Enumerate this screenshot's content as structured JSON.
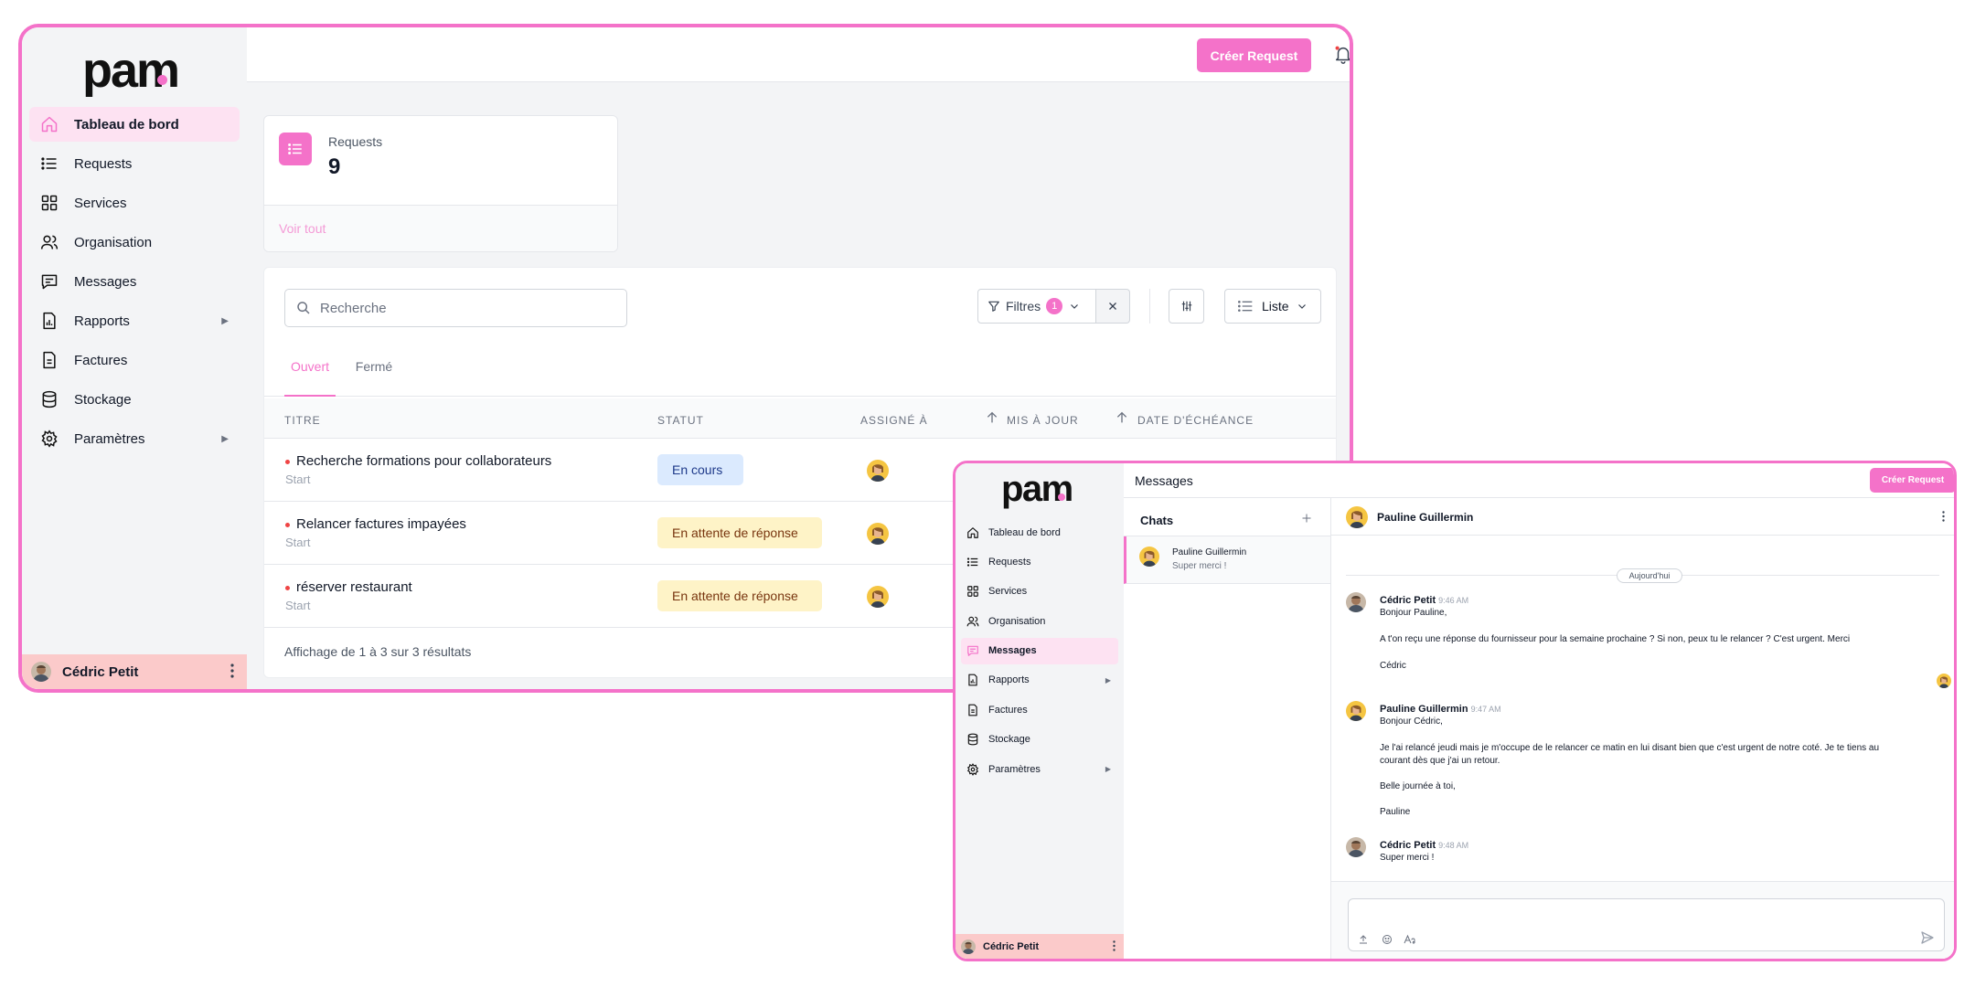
{
  "app": {
    "logo_text": "pam",
    "brand_color": "#f472c9"
  },
  "dashboard": {
    "sidebar": {
      "items": [
        {
          "label": "Tableau de bord",
          "icon": "home-icon",
          "active": true
        },
        {
          "label": "Requests",
          "icon": "list-icon"
        },
        {
          "label": "Services",
          "icon": "grid-icon"
        },
        {
          "label": "Organisation",
          "icon": "users-icon"
        },
        {
          "label": "Messages",
          "icon": "chat-icon"
        },
        {
          "label": "Rapports",
          "icon": "report-icon",
          "has_submenu": true
        },
        {
          "label": "Factures",
          "icon": "invoice-icon"
        },
        {
          "label": "Stockage",
          "icon": "database-icon"
        },
        {
          "label": "Paramètres",
          "icon": "gear-icon",
          "has_submenu": true
        }
      ],
      "user_name": "Cédric Petit"
    },
    "header": {
      "create_button": "Créer Request"
    },
    "stat_card": {
      "label": "Requests",
      "value": "9",
      "link": "Voir tout"
    },
    "toolbar": {
      "search_placeholder": "Recherche",
      "filters_label": "Filtres",
      "filters_count": "1",
      "view_label": "Liste"
    },
    "tabs": [
      {
        "label": "Ouvert",
        "active": true
      },
      {
        "label": "Fermé"
      }
    ],
    "table": {
      "headers": {
        "title": "Titre",
        "status": "Statut",
        "assigned": "Assigné à",
        "updated": "Mis à jour",
        "due": "Date d'échéance"
      },
      "rows": [
        {
          "title": "Recherche formations pour collaborateurs",
          "sub": "Start",
          "status": "En cours",
          "status_color": "#dbeafe"
        },
        {
          "title": "Relancer factures impayées",
          "sub": "Start",
          "status": "En attente de réponse",
          "status_color": "#fef3c7"
        },
        {
          "title": "réserver restaurant",
          "sub": "Start",
          "status": "En attente de réponse",
          "status_color": "#fef3c7"
        }
      ],
      "footer": "Affichage de 1 à 3 sur 3 résultats"
    }
  },
  "messages_window": {
    "sidebar": {
      "items": [
        {
          "label": "Tableau de bord",
          "icon": "home-icon"
        },
        {
          "label": "Requests",
          "icon": "list-icon"
        },
        {
          "label": "Services",
          "icon": "grid-icon"
        },
        {
          "label": "Organisation",
          "icon": "users-icon"
        },
        {
          "label": "Messages",
          "icon": "chat-icon",
          "active": true
        },
        {
          "label": "Rapports",
          "icon": "report-icon",
          "has_submenu": true
        },
        {
          "label": "Factures",
          "icon": "invoice-icon"
        },
        {
          "label": "Stockage",
          "icon": "database-icon"
        },
        {
          "label": "Paramètres",
          "icon": "gear-icon",
          "has_submenu": true
        }
      ],
      "user_name": "Cédric Petit"
    },
    "header": {
      "title": "Messages",
      "create_button": "Créer Request"
    },
    "chats": {
      "title": "Chats",
      "list": [
        {
          "name": "Pauline Guillermin",
          "preview": "Super merci !"
        }
      ]
    },
    "conversation": {
      "contact_name": "Pauline Guillermin",
      "date_divider": "Aujourd'hui",
      "messages": [
        {
          "author": "Cédric Petit",
          "time": "9:46 AM",
          "lines": [
            "Bonjour Pauline,",
            "A t'on reçu une réponse du fournisseur pour la semaine prochaine ? Si non, peux tu le relancer ? C'est urgent. Merci",
            "Cédric"
          ]
        },
        {
          "author": "Pauline Guillermin",
          "time": "9:47 AM",
          "lines": [
            "Bonjour Cédric,",
            "Je l'ai relancé jeudi mais je m'occupe de le relancer ce matin en lui disant bien que c'est urgent de notre coté. Je te tiens au",
            "courant dès que j'ai un retour.",
            "Belle journée à toi,",
            "Pauline"
          ]
        },
        {
          "author": "Cédric Petit",
          "time": "9:48 AM",
          "lines": [
            "Super merci !"
          ]
        }
      ]
    }
  }
}
